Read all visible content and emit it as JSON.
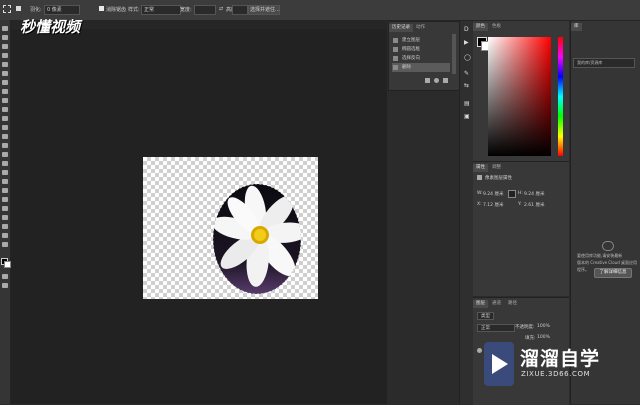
{
  "options_bar": {
    "label_feather": "羽化:",
    "feather_value": "0 像素",
    "label_antialias": "消除锯齿",
    "label_style": "样式:",
    "style_value": "正常",
    "label_width": "宽度:",
    "label_height": "高度:",
    "select_mask_button": "选择并遮住..."
  },
  "watermark_top": {
    "text": "秒懂视频"
  },
  "history_panel": {
    "tabs": [
      "历史记录",
      "动作"
    ],
    "items": [
      "建立图层",
      "椭圆选框",
      "选择反向",
      "删除"
    ],
    "selected_index": 3
  },
  "color_panel": {
    "tabs": [
      "颜色",
      "色板"
    ],
    "fg_color": "#000000",
    "bg_color": "#ffffff"
  },
  "properties_panel": {
    "tabs": [
      "属性",
      "调整"
    ],
    "title": "像素图层属性",
    "w_label": "W:",
    "w_value": "9.24 厘米",
    "h_label": "H:",
    "h_value": "9.24 厘米",
    "x_label": "X:",
    "x_value": "7.12 厘米",
    "y_label": "Y:",
    "y_value": "2.61 厘米"
  },
  "layers_panel": {
    "tabs": [
      "图层",
      "通道",
      "路径"
    ],
    "filter_label": "类型",
    "blend_mode": "正常",
    "opacity_label": "不透明度:",
    "opacity_value": "100%",
    "fill_label": "填充:",
    "fill_value": "100%"
  },
  "library_panel": {
    "title": "库",
    "dropdown": "我的库/资源库",
    "message_lines": [
      "要使用库功能,请安装最新",
      "版本的 Creative Cloud 桌面应用",
      "程序。"
    ],
    "button": "了解详细信息"
  },
  "watermark_bottom": {
    "big": "溜溜自学",
    "small": "ZIXUE.3D66.COM"
  }
}
